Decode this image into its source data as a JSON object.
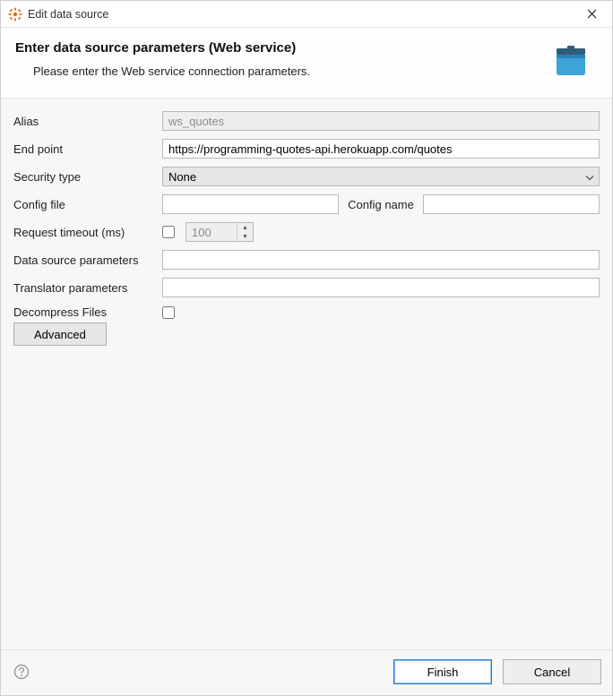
{
  "window": {
    "title": "Edit data source"
  },
  "header": {
    "heading": "Enter data source parameters (Web service)",
    "subtitle": "Please enter the Web service connection parameters."
  },
  "form": {
    "alias_label": "Alias",
    "alias_value": "ws_quotes",
    "endpoint_label": "End point",
    "endpoint_value": "https://programming-quotes-api.herokuapp.com/quotes",
    "security_label": "Security type",
    "security_value": "None",
    "config_file_label": "Config file",
    "config_file_value": "",
    "config_name_label": "Config name",
    "config_name_value": "",
    "timeout_label": "Request timeout (ms)",
    "timeout_value": "100",
    "dsp_label": "Data source parameters",
    "dsp_value": "",
    "tp_label": "Translator parameters",
    "tp_value": "",
    "decompress_label": "Decompress Files",
    "advanced_label": "Advanced"
  },
  "footer": {
    "finish": "Finish",
    "cancel": "Cancel"
  }
}
